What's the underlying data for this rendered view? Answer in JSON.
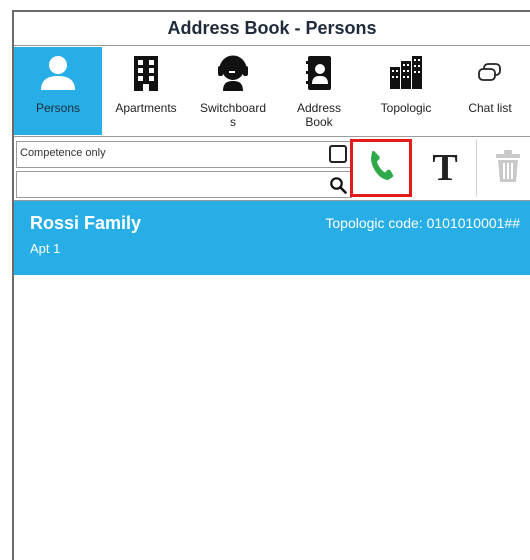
{
  "window": {
    "title": "Address Book - Persons"
  },
  "nav": {
    "items": [
      {
        "label": "Persons",
        "icon": "person-icon",
        "active": true
      },
      {
        "label": "Apartments",
        "icon": "building-icon",
        "active": false
      },
      {
        "label": "Switchboard\ns",
        "icon": "headset-operator-icon",
        "active": false
      },
      {
        "label": "Address\nBook",
        "icon": "address-book-icon",
        "active": false
      },
      {
        "label": "Topologic",
        "icon": "buildings-icon",
        "active": false
      },
      {
        "label": "Chat list",
        "icon": "chat-icon",
        "active": false
      }
    ]
  },
  "toolbar": {
    "competence_label": "Competence only",
    "competence_checked": false,
    "search_value": "",
    "search_placeholder": ""
  },
  "colors": {
    "accent": "#27aee6",
    "call_green": "#2eaa4a",
    "highlight_red": "#e11b1b"
  },
  "list": {
    "items": [
      {
        "name": "Rossi Family",
        "subtitle": "Apt 1",
        "code_label": "Topologic code:",
        "code_value": "0101010001##"
      }
    ]
  }
}
